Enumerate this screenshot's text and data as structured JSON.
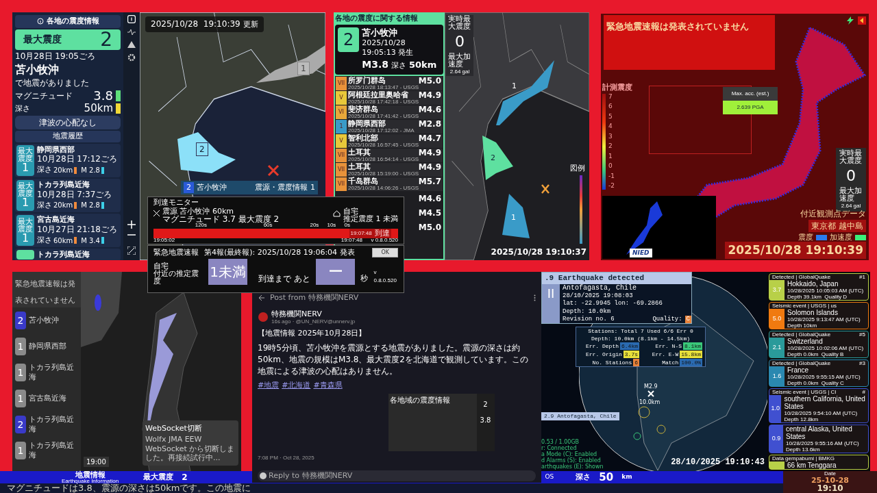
{
  "p1": {
    "header": "各地の震度情報",
    "time": "2025/10/28  19:10:39",
    "time_suffix": "更新",
    "max_label": "最大震度",
    "max_value": "2",
    "date": "10月28日 19:05ごろ",
    "place": "苫小牧沖",
    "note": "で地震がありました",
    "mag_label": "マグニチュード",
    "mag": "3.8",
    "depth_label": "深さ",
    "depth": "50km",
    "tsunami": "津波の心配なし",
    "history_title": "地震履歴",
    "history": [
      {
        "badge": "最大震度",
        "int": "1",
        "color": "#2a9bb0",
        "place": "静岡県西部",
        "date": "10月28日 17:12ごろ",
        "depth_label": "深さ",
        "depth": "20km",
        "mag": "M 2.8"
      },
      {
        "badge": "最大震度",
        "int": "1",
        "color": "#2a9bb0",
        "place": "トカラ列島近海",
        "date": "10月28日 7:37ごろ",
        "depth_label": "深さ",
        "depth": "20km",
        "mag": "M 2.8"
      },
      {
        "badge": "最大震度",
        "int": "1",
        "color": "#2a9bb0",
        "place": "宮古島近海",
        "date": "10月27日 21:18ごろ",
        "depth_label": "深さ",
        "depth": "60km",
        "mag": "M 3.4"
      },
      {
        "color": "#5ee0a0",
        "place": "トカラ列島近海"
      }
    ],
    "map_labels": [
      {
        "text": "1",
        "kind": "gray"
      },
      {
        "text": "2",
        "kind": "blue"
      }
    ],
    "mini": {
      "int": "2",
      "place": "苫小牧沖",
      "title": "震源・震度情報",
      "value": "1"
    }
  },
  "p2": {
    "header": "各地の震度に関する情報",
    "int": "2",
    "place": "苫小牧沖",
    "time": "2025/10/28 19:05:13 発生",
    "mag": "M3.8",
    "depth_label": "深さ",
    "depth": "50km",
    "rt_label": "実時最大震度",
    "rt_value": "0",
    "acc_label": "最大加速度",
    "acc_value": "2.64 gal",
    "list": [
      {
        "int": "VII",
        "color": "#e8923a",
        "place": "所罗门群岛",
        "time": "2025/10/28 18:13:47 - USGS",
        "mag": "M5.0"
      },
      {
        "int": "V",
        "color": "#e8c83a",
        "place": "阿根廷拉里奥哈省",
        "time": "2025/10/28 17:42:18 - USGS",
        "mag": "M4.9"
      },
      {
        "int": "VI",
        "color": "#e8a83a",
        "place": "斐济群岛",
        "time": "2025/10/28 17:41:42 - USGS",
        "mag": "M4.6"
      },
      {
        "int": "1",
        "color": "#3a9bc8",
        "place": "静岡県西部",
        "time": "2025/10/28 17:12:02 - JMA",
        "mag": "M2.8"
      },
      {
        "int": "V",
        "color": "#e8c83a",
        "place": "智利北部",
        "time": "2025/10/28 16:57:45 - USGS",
        "mag": "M4.7"
      },
      {
        "int": "VII",
        "color": "#e8923a",
        "place": "土耳其",
        "time": "2025/10/28 16:54:14 - USGS",
        "mag": "M4.9"
      },
      {
        "int": "VII",
        "color": "#e8923a",
        "place": "土耳其",
        "time": "2025/10/28 15:19:00 - USGS",
        "mag": "M4.9"
      },
      {
        "int": "VII",
        "color": "#e8923a",
        "place": "千岛群岛",
        "time": "2025/10/28 14:06:26 - USGS",
        "mag": "M5.7"
      },
      {
        "mag": "M4.6"
      },
      {
        "mag": "M4.5"
      },
      {
        "mag": "M5.0"
      }
    ],
    "map_labels": [
      "1",
      "2",
      "1"
    ],
    "legend_title": "図例",
    "timestamp": "2025/10/28 19:10:37"
  },
  "p3": {
    "title": "緊急地震速報は発表されていません",
    "scale_title": "計測震度",
    "scale": [
      "7",
      "6",
      "5",
      "4",
      "3",
      "2",
      "1",
      "0",
      "-1",
      "-2"
    ],
    "tooltip_label": "Max. acc. (est.)",
    "tooltip_value": "2.639 PGA",
    "rt_label": "実時最大震度",
    "rt_value": "0",
    "acc_label": "最大加速度",
    "acc_value": "2.64 gal",
    "nearby": "付近観測点データ",
    "station": "東京都 越中島",
    "legend": [
      {
        "label": "震度",
        "color": "#2a7af0"
      },
      {
        "label": "加速度",
        "color": "#3af07a"
      }
    ],
    "timestamp": "2025/10/28 19:10:39",
    "inset_logo": "NIED"
  },
  "p4": {
    "status": "緊急地震速報は発表されていません",
    "list": [
      {
        "int": "2",
        "color": "#3a3ac8",
        "place": "苫小牧沖"
      },
      {
        "int": "1",
        "color": "#8a8a8a",
        "place": "静岡県西部"
      },
      {
        "int": "1",
        "color": "#8a8a8a",
        "place": "トカラ列島近海"
      },
      {
        "int": "1",
        "color": "#8a8a8a",
        "place": "宮古島近海"
      },
      {
        "int": "2",
        "color": "#3a3ac8",
        "place": "トカラ列島近海"
      },
      {
        "int": "1",
        "color": "#8a8a8a",
        "place": "トカラ列島近海"
      }
    ],
    "clock": "19:00",
    "toast_title": "WebSocket切断",
    "toast_text": "Wolfx JMA EEW WebSocket から切断しました。再接続試行中..."
  },
  "p5": {
    "header": "Post from 特務機関NERV",
    "author": "特務機関NERV",
    "handle": "16s ago · @UN_NERV@unnerv.jp",
    "title": "【地震情報 2025年10月28日】",
    "body": "19時5分頃、苫小牧沖を震源とする地震がありました。震源の深さは約50km、地震の規模はM3.8、最大震度2を北海道で観測しています。この地震による津波の心配はありません。",
    "tags": [
      "#地震",
      "#北海道",
      "#青森県"
    ],
    "image_title": "各地域の震度情報",
    "image_values": [
      "2",
      "3.8"
    ],
    "posted": "7:08 PM · Oct 28, 2025",
    "reply_placeholder": "Reply to 特務機関NERV"
  },
  "p6": {
    "header": ".9 Earthquake detected",
    "intensity": "II",
    "place": "Antofagasta, Chile",
    "time": "28/10/2025 19:08:03",
    "coords": "lat: -22.9945 lon: -69.2866",
    "depth": "Depth: 10.0km",
    "revision": "Revision no. 6",
    "quality_label": "Quality:",
    "quality": "C",
    "stations": "Stations: Total 7 Used 6/6 Err 0",
    "depth_range": "Depth: 10.0km (8.1km - 14.5km)",
    "errors": [
      {
        "label": "Err. Depth",
        "value": "6.4km",
        "color": "#2a6ab0"
      },
      {
        "label": "Err. N-S",
        "value": "8.1km",
        "color": "#3ac87a"
      },
      {
        "label": "Err. Origin",
        "value": "3.7s",
        "color": "#e8e03a"
      },
      {
        "label": "Err. E-W",
        "value": "15.8km",
        "color": "#e8e03a"
      },
      {
        "label": "No. Stations",
        "value": "6",
        "color": "#e8823a"
      },
      {
        "label": "Match",
        "value": "100.0%",
        "color": "#2a6ab0"
      }
    ],
    "marker_mag": "M2.9",
    "marker_depth": "10.0km",
    "map_label": "2.9 Antofagasta, Chile",
    "status": [
      "0.53 / 1.00GB",
      "r: Connected",
      "a Mode (C): Enabled",
      "d Alarms (S): Enabled",
      "arthquakes (E): Shown"
    ],
    "timestamp": "28/10/2025 19:10:43"
  },
  "feed": [
    {
      "source": "Detected | GlobalQuake",
      "num": "#1",
      "mag": "3.7",
      "place": "Hokkaido, Japan",
      "time": "10/28/2025 10:05:03 AM (UTC)",
      "detail": "Depth 39.1km  Quality D",
      "color": "#b8d048"
    },
    {
      "source": "Seismic event | USGS | us",
      "mag": "5.0",
      "place": "Solomon Islands",
      "time": "10/28/2025 9:13:47 AM (UTC)",
      "detail": "Depth 10km",
      "color": "#f07a10"
    },
    {
      "source": "Detected | GlobalQuake",
      "num": "#5",
      "mag": "2.1",
      "place": "Switzerland",
      "time": "10/28/2025 10:02:06 AM (UTC)",
      "detail": "Depth 0.0km  Quality B",
      "color": "#2a9a9a"
    },
    {
      "source": "Detected | GlobalQuake",
      "num": "#3",
      "mag": "1.6",
      "place": "France",
      "time": "10/28/2025 9:55:15 AM (UTC)",
      "detail": "Depth 0.0km  Quality C",
      "color": "#2a88b0"
    },
    {
      "source": "Seismic event | USGS | CI",
      "num": "#",
      "mag": "1.0",
      "place": "southern California, United States",
      "time": "10/28/2025 9:54:10 AM (UTC)",
      "detail": "Depth 12.8km",
      "color": "#4050d0"
    },
    {
      "mag": "0.9",
      "place": "central Alaska, United States",
      "time": "10/28/2025 9:55:16 AM (UTC)",
      "detail": "Depth 13.6km",
      "color": "#4050d0"
    },
    {
      "source": "Data gempabumi | BMKG",
      "place": "66 km Tenggara",
      "color": "#b8d048"
    }
  ],
  "monitor": {
    "title": "到達モニター",
    "line1": "震源  苫小牧沖 60km",
    "line2": "マグニチュード 3.7  最大震度 2",
    "home": "自宅",
    "home_est": "推定震度 1 未満",
    "ticks": [
      "120s",
      "60s",
      "20s",
      "10s",
      "0s"
    ],
    "arrival_time": "19:07:48",
    "arrival_label": "到達",
    "start": "19:05:02",
    "end": "19:07:48",
    "version": "v 0.8.0.520"
  },
  "eew": {
    "title": "緊急地震速報",
    "report": "第4報(最終報): 2025/10/28 19:06:04 発表",
    "ok": "OK",
    "home": "自宅",
    "est_label": "付近の推定震度",
    "est": "1未満",
    "until": "到達まで あと",
    "seconds": "ー",
    "unit": "秒",
    "version": "v 0.8.0.520"
  },
  "ticker": {
    "title": "地震情報",
    "subtitle": "Earthquake Information",
    "max_label": "最大震度",
    "max_value": "2",
    "cut": "OS",
    "depth_label": "深さ",
    "depth": "50",
    "unit": "km",
    "scroll": "マグニチュードは3.8、震源の深さは50kmです。この地震に",
    "date_label": "Date",
    "date": "25-10-28",
    "clock": "19:10"
  }
}
